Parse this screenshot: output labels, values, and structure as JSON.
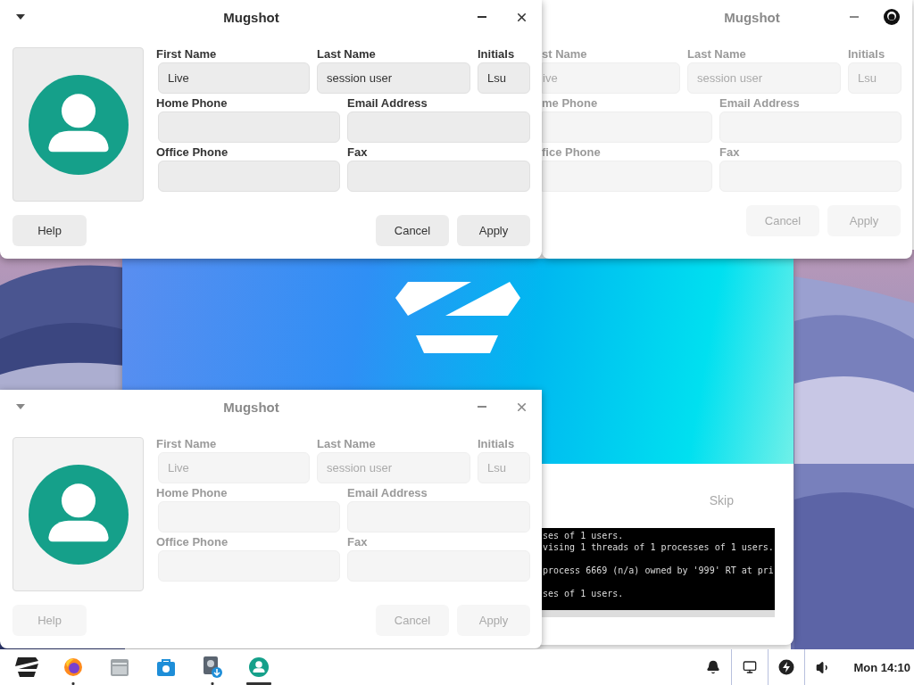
{
  "installer": {
    "skip": "Skip",
    "terminal_lines": [
      {
        "text": "ses of 1 users.",
        "gap_before": false
      },
      {
        "text": "vising 1 threads of 1 processes of 1 users.",
        "gap_before": false
      },
      {
        "text": "process 6669 (n/a) owned by '999' RT at pri",
        "gap_before": true
      },
      {
        "text": "ses of 1 users.",
        "gap_before": true
      }
    ]
  },
  "windows": [
    {
      "title": "Mugshot",
      "active": true,
      "rows": [
        [
          {
            "label": "First Name",
            "value": "Live"
          },
          {
            "label": "Last Name",
            "value": "session user"
          },
          {
            "label": "Initials",
            "value": "Lsu"
          }
        ],
        [
          {
            "label": "Home Phone"
          },
          {
            "label": "Email Address"
          }
        ],
        [
          {
            "label": "Office Phone"
          },
          {
            "label": "Fax"
          }
        ]
      ],
      "help": "Help",
      "buttons": [
        "Cancel",
        "Apply"
      ]
    },
    {
      "title": "Mugshot",
      "active": false,
      "rows": [
        [
          {
            "label": "First Name",
            "value": "Live"
          },
          {
            "label": "Last Name",
            "value": "session user"
          },
          {
            "label": "Initials",
            "value": "Lsu"
          }
        ],
        [
          {
            "label": "Home Phone"
          },
          {
            "label": "Email Address"
          }
        ],
        [
          {
            "label": "Office Phone"
          },
          {
            "label": "Fax"
          }
        ]
      ],
      "help": "Help",
      "buttons": [
        "Cancel",
        "Apply"
      ]
    }
  ],
  "clipped_window": {
    "title": "Mugshot",
    "rows": [
      [
        {
          "label": "st Name",
          "value": "ive"
        },
        {
          "label": "Last Name",
          "value": "session user"
        },
        {
          "label": "Initials",
          "value": "Lsu"
        }
      ],
      [
        {
          "label": "me Phone"
        },
        {
          "label": "Email Address"
        }
      ],
      [
        {
          "label": "fice Phone"
        },
        {
          "label": "Fax"
        }
      ]
    ],
    "buttons": [
      "Cancel",
      "Apply"
    ]
  },
  "taskbar": {
    "apps": [
      {
        "kind": "menu",
        "running": false,
        "focused": false
      },
      {
        "kind": "browser",
        "running": true,
        "focused": false
      },
      {
        "kind": "files",
        "running": false,
        "focused": false
      },
      {
        "kind": "store",
        "running": false,
        "focused": false
      },
      {
        "kind": "installer",
        "running": true,
        "focused": false
      },
      {
        "kind": "mugshot",
        "running": true,
        "focused": true
      }
    ],
    "clock": "Mon 14:10"
  }
}
